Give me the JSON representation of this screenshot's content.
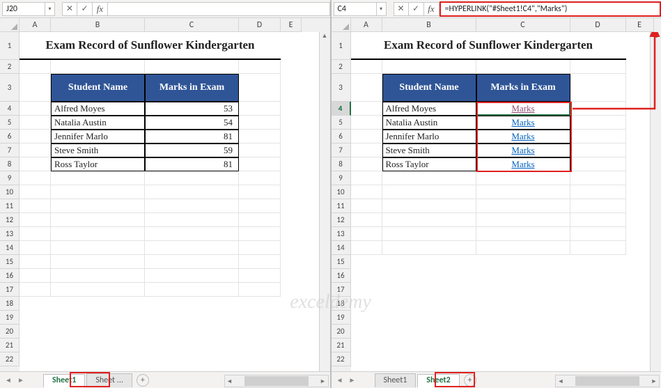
{
  "left": {
    "namebox": "J20",
    "formula": "",
    "columns": [
      "A",
      "B",
      "C",
      "D",
      "E"
    ],
    "rows": [
      "1",
      "2",
      "3",
      "4",
      "5",
      "6",
      "7",
      "8",
      "9",
      "10",
      "11",
      "12",
      "13",
      "14",
      "15",
      "16",
      "17",
      "18",
      "19",
      "20",
      "21",
      "22"
    ],
    "title": "Exam Record of Sunflower Kindergarten",
    "headers": {
      "b": "Student Name",
      "c": "Marks in Exam"
    },
    "data": [
      {
        "name": "Alfred Moyes",
        "marks": "53"
      },
      {
        "name": "Natalia Austin",
        "marks": "54"
      },
      {
        "name": "Jennifer Marlo",
        "marks": "81"
      },
      {
        "name": "Steve Smith",
        "marks": "59"
      },
      {
        "name": "Ross Taylor",
        "marks": "81"
      }
    ],
    "tabs": {
      "active": "Sheet1",
      "other": "Sheet ...",
      "add": "+"
    }
  },
  "right": {
    "namebox": "C4",
    "formula": "=HYPERLINK(\"#Sheet1!C4\",\"Marks\")",
    "columns": [
      "A",
      "B",
      "C",
      "D",
      "E"
    ],
    "rows": [
      "1",
      "2",
      "3",
      "4",
      "5",
      "6",
      "7",
      "8",
      "9",
      "10",
      "11",
      "12",
      "13",
      "14",
      "15",
      "16",
      "17",
      "18",
      "19",
      "20",
      "21",
      "22"
    ],
    "title": "Exam Record of Sunflower Kindergarten",
    "headers": {
      "b": "Student Name",
      "c": "Marks in Exam"
    },
    "data": [
      {
        "name": "Alfred Moyes",
        "marks": "Marks",
        "visited": true
      },
      {
        "name": "Natalia Austin",
        "marks": "Marks"
      },
      {
        "name": "Jennifer Marlo",
        "marks": "Marks"
      },
      {
        "name": "Steve Smith",
        "marks": "Marks"
      },
      {
        "name": "Ross Taylor",
        "marks": "Marks"
      }
    ],
    "tabs": {
      "other": "Sheet1",
      "active": "Sheet2",
      "add": "+"
    }
  },
  "fx": "fx",
  "watermark": "exceldemy",
  "chart_data": {
    "type": "table",
    "title": "Exam Record of Sunflower Kindergarten",
    "columns": [
      "Student Name",
      "Marks in Exam"
    ],
    "rows": [
      [
        "Alfred Moyes",
        53
      ],
      [
        "Natalia Austin",
        54
      ],
      [
        "Jennifer Marlo",
        81
      ],
      [
        "Steve Smith",
        59
      ],
      [
        "Ross Taylor",
        81
      ]
    ]
  }
}
